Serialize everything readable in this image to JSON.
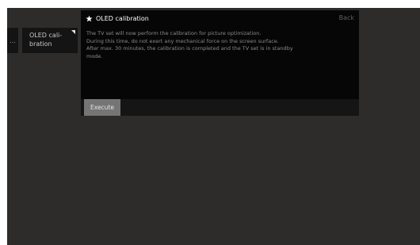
{
  "breadcrumb": {
    "previous_label": "...",
    "current_label": "OLED cali-\nbration"
  },
  "dialog": {
    "title": "OLED calibration",
    "back_label": "Back",
    "body_lines": [
      "The TV set will now perform the calibration for picture optimization.",
      "During this time, do not exert any mechanical force on the screen surface.",
      "After max. 30 minutes, the calibration is completed and the TV set is in standby",
      "mode."
    ],
    "execute_label": "Execute"
  },
  "icons": {
    "title_icon": "star-icon",
    "crumb_corner": "corner-marker-icon"
  },
  "colors": {
    "screen_bg": "#2e2b2b",
    "dialog_bg": "#060606",
    "button_bg": "#757575"
  }
}
